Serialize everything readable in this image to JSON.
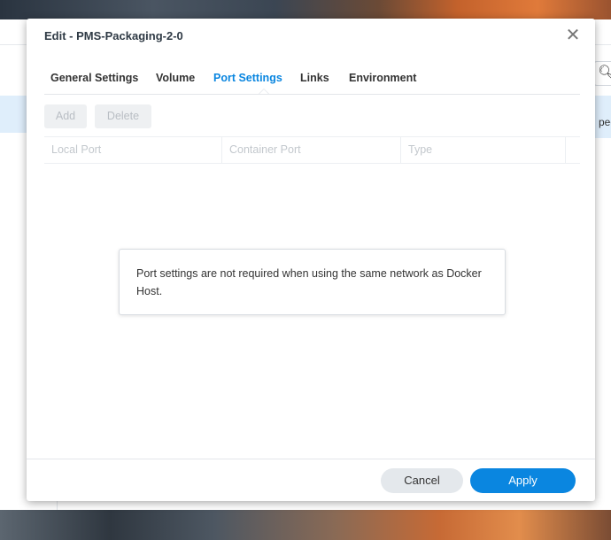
{
  "colors": {
    "accent": "#0a86e0",
    "modal_bg": "#ffffff",
    "cancel_bg": "#e4e8ec",
    "disabled_text": "#b9bec4"
  },
  "dialog": {
    "title": "Edit - PMS-Packaging-2-0",
    "close_icon": "close-icon"
  },
  "background_app": {
    "search_icon": "search-icon",
    "truncated_text": "pec"
  },
  "tabs": [
    {
      "label": "General Settings",
      "active": false
    },
    {
      "label": "Volume",
      "active": false
    },
    {
      "label": "Port Settings",
      "active": true
    },
    {
      "label": "Links",
      "active": false
    },
    {
      "label": "Environment",
      "active": false
    }
  ],
  "toolbar": {
    "add_label": "Add",
    "delete_label": "Delete",
    "add_disabled": true,
    "delete_disabled": true
  },
  "table": {
    "columns": [
      "Local Port",
      "Container Port",
      "Type"
    ],
    "rows": []
  },
  "message": {
    "text": "Port settings are not required when using the same network as Docker Host."
  },
  "footer": {
    "cancel_label": "Cancel",
    "apply_label": "Apply"
  }
}
